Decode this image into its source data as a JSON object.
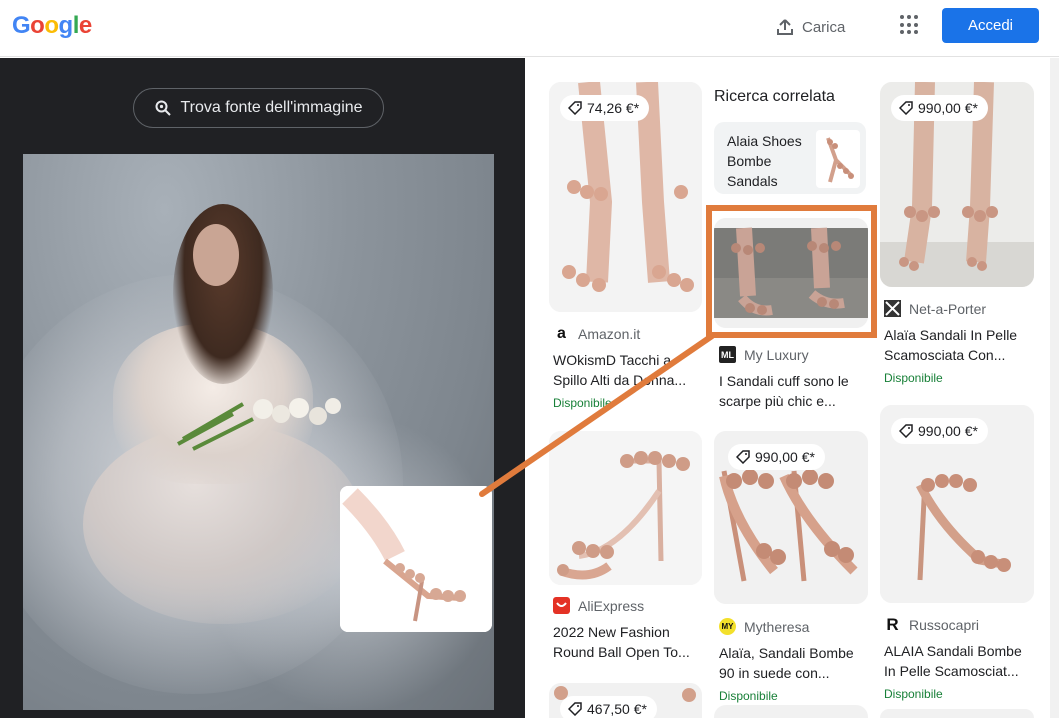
{
  "header": {
    "logo_letters": [
      "G",
      "o",
      "o",
      "g",
      "l",
      "e"
    ],
    "logo_colors": [
      "#4285f4",
      "#ea4335",
      "#fbbc05",
      "#4285f4",
      "#34a853",
      "#ea4335"
    ],
    "upload_label": "Carica",
    "signin_label": "Accedi"
  },
  "left": {
    "find_source_label": "Trova fonte dell'immagine"
  },
  "related": {
    "heading": "Ricerca correlata",
    "chip_label": "Alaia Shoes Bombe Sandals"
  },
  "results": [
    {
      "price": "74,26 €*",
      "source": "Amazon.it",
      "title": "WOkismD Tacchi a Spillo Alti da Donna...",
      "availability": "Disponibile"
    },
    {
      "price": "",
      "source": "My Luxury",
      "title": "I Sandali cuff sono le scarpe più chic e...",
      "availability": ""
    },
    {
      "price": "990,00 €*",
      "source": "Net-a-Porter",
      "title": "Alaïa Sandali In Pelle Scamosciata Con...",
      "availability": "Disponibile"
    },
    {
      "price": "",
      "source": "AliExpress",
      "title": "2022 New Fashion Round Ball Open To...",
      "availability": ""
    },
    {
      "price": "990,00 €*",
      "source": "Mytheresa",
      "title": "Alaïa, Sandali Bombe 90 in suede con...",
      "availability": "Disponibile"
    },
    {
      "price": "990,00 €*",
      "source": "Russocapri",
      "title": "ALAIA Sandali Bombe In Pelle Scamosciat...",
      "availability": "Disponibile"
    },
    {
      "price": "467,50 €*",
      "source": "",
      "title": "",
      "availability": ""
    }
  ],
  "favicons": {
    "amazon": "a",
    "myluxury": "ML",
    "mytheresa": "MY",
    "russocapri": "R"
  },
  "colors": {
    "accent_blue": "#1a73e8",
    "highlight_orange": "#e07b3c",
    "available_green": "#188038",
    "dark_panel": "#202124"
  }
}
